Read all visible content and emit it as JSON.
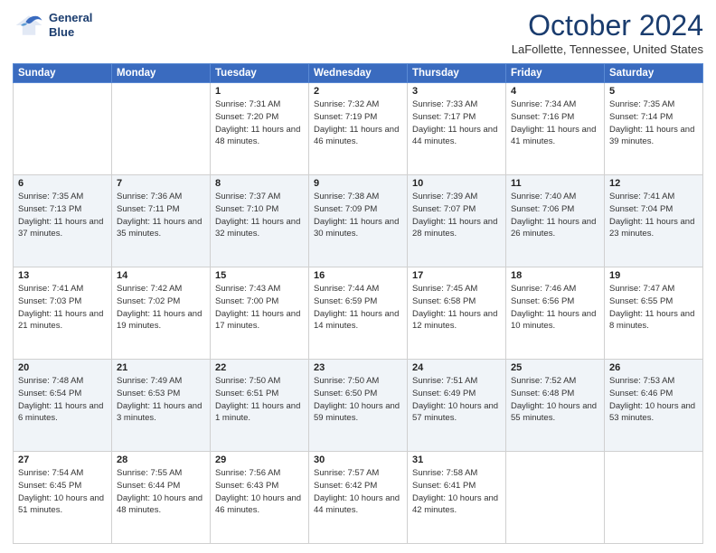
{
  "header": {
    "logo_line1": "General",
    "logo_line2": "Blue",
    "month": "October 2024",
    "location": "LaFollette, Tennessee, United States"
  },
  "weekdays": [
    "Sunday",
    "Monday",
    "Tuesday",
    "Wednesday",
    "Thursday",
    "Friday",
    "Saturday"
  ],
  "rows": [
    [
      {
        "day": "",
        "info": ""
      },
      {
        "day": "",
        "info": ""
      },
      {
        "day": "1",
        "info": "Sunrise: 7:31 AM\nSunset: 7:20 PM\nDaylight: 11 hours and 48 minutes."
      },
      {
        "day": "2",
        "info": "Sunrise: 7:32 AM\nSunset: 7:19 PM\nDaylight: 11 hours and 46 minutes."
      },
      {
        "day": "3",
        "info": "Sunrise: 7:33 AM\nSunset: 7:17 PM\nDaylight: 11 hours and 44 minutes."
      },
      {
        "day": "4",
        "info": "Sunrise: 7:34 AM\nSunset: 7:16 PM\nDaylight: 11 hours and 41 minutes."
      },
      {
        "day": "5",
        "info": "Sunrise: 7:35 AM\nSunset: 7:14 PM\nDaylight: 11 hours and 39 minutes."
      }
    ],
    [
      {
        "day": "6",
        "info": "Sunrise: 7:35 AM\nSunset: 7:13 PM\nDaylight: 11 hours and 37 minutes."
      },
      {
        "day": "7",
        "info": "Sunrise: 7:36 AM\nSunset: 7:11 PM\nDaylight: 11 hours and 35 minutes."
      },
      {
        "day": "8",
        "info": "Sunrise: 7:37 AM\nSunset: 7:10 PM\nDaylight: 11 hours and 32 minutes."
      },
      {
        "day": "9",
        "info": "Sunrise: 7:38 AM\nSunset: 7:09 PM\nDaylight: 11 hours and 30 minutes."
      },
      {
        "day": "10",
        "info": "Sunrise: 7:39 AM\nSunset: 7:07 PM\nDaylight: 11 hours and 28 minutes."
      },
      {
        "day": "11",
        "info": "Sunrise: 7:40 AM\nSunset: 7:06 PM\nDaylight: 11 hours and 26 minutes."
      },
      {
        "day": "12",
        "info": "Sunrise: 7:41 AM\nSunset: 7:04 PM\nDaylight: 11 hours and 23 minutes."
      }
    ],
    [
      {
        "day": "13",
        "info": "Sunrise: 7:41 AM\nSunset: 7:03 PM\nDaylight: 11 hours and 21 minutes."
      },
      {
        "day": "14",
        "info": "Sunrise: 7:42 AM\nSunset: 7:02 PM\nDaylight: 11 hours and 19 minutes."
      },
      {
        "day": "15",
        "info": "Sunrise: 7:43 AM\nSunset: 7:00 PM\nDaylight: 11 hours and 17 minutes."
      },
      {
        "day": "16",
        "info": "Sunrise: 7:44 AM\nSunset: 6:59 PM\nDaylight: 11 hours and 14 minutes."
      },
      {
        "day": "17",
        "info": "Sunrise: 7:45 AM\nSunset: 6:58 PM\nDaylight: 11 hours and 12 minutes."
      },
      {
        "day": "18",
        "info": "Sunrise: 7:46 AM\nSunset: 6:56 PM\nDaylight: 11 hours and 10 minutes."
      },
      {
        "day": "19",
        "info": "Sunrise: 7:47 AM\nSunset: 6:55 PM\nDaylight: 11 hours and 8 minutes."
      }
    ],
    [
      {
        "day": "20",
        "info": "Sunrise: 7:48 AM\nSunset: 6:54 PM\nDaylight: 11 hours and 6 minutes."
      },
      {
        "day": "21",
        "info": "Sunrise: 7:49 AM\nSunset: 6:53 PM\nDaylight: 11 hours and 3 minutes."
      },
      {
        "day": "22",
        "info": "Sunrise: 7:50 AM\nSunset: 6:51 PM\nDaylight: 11 hours and 1 minute."
      },
      {
        "day": "23",
        "info": "Sunrise: 7:50 AM\nSunset: 6:50 PM\nDaylight: 10 hours and 59 minutes."
      },
      {
        "day": "24",
        "info": "Sunrise: 7:51 AM\nSunset: 6:49 PM\nDaylight: 10 hours and 57 minutes."
      },
      {
        "day": "25",
        "info": "Sunrise: 7:52 AM\nSunset: 6:48 PM\nDaylight: 10 hours and 55 minutes."
      },
      {
        "day": "26",
        "info": "Sunrise: 7:53 AM\nSunset: 6:46 PM\nDaylight: 10 hours and 53 minutes."
      }
    ],
    [
      {
        "day": "27",
        "info": "Sunrise: 7:54 AM\nSunset: 6:45 PM\nDaylight: 10 hours and 51 minutes."
      },
      {
        "day": "28",
        "info": "Sunrise: 7:55 AM\nSunset: 6:44 PM\nDaylight: 10 hours and 48 minutes."
      },
      {
        "day": "29",
        "info": "Sunrise: 7:56 AM\nSunset: 6:43 PM\nDaylight: 10 hours and 46 minutes."
      },
      {
        "day": "30",
        "info": "Sunrise: 7:57 AM\nSunset: 6:42 PM\nDaylight: 10 hours and 44 minutes."
      },
      {
        "day": "31",
        "info": "Sunrise: 7:58 AM\nSunset: 6:41 PM\nDaylight: 10 hours and 42 minutes."
      },
      {
        "day": "",
        "info": ""
      },
      {
        "day": "",
        "info": ""
      }
    ]
  ]
}
